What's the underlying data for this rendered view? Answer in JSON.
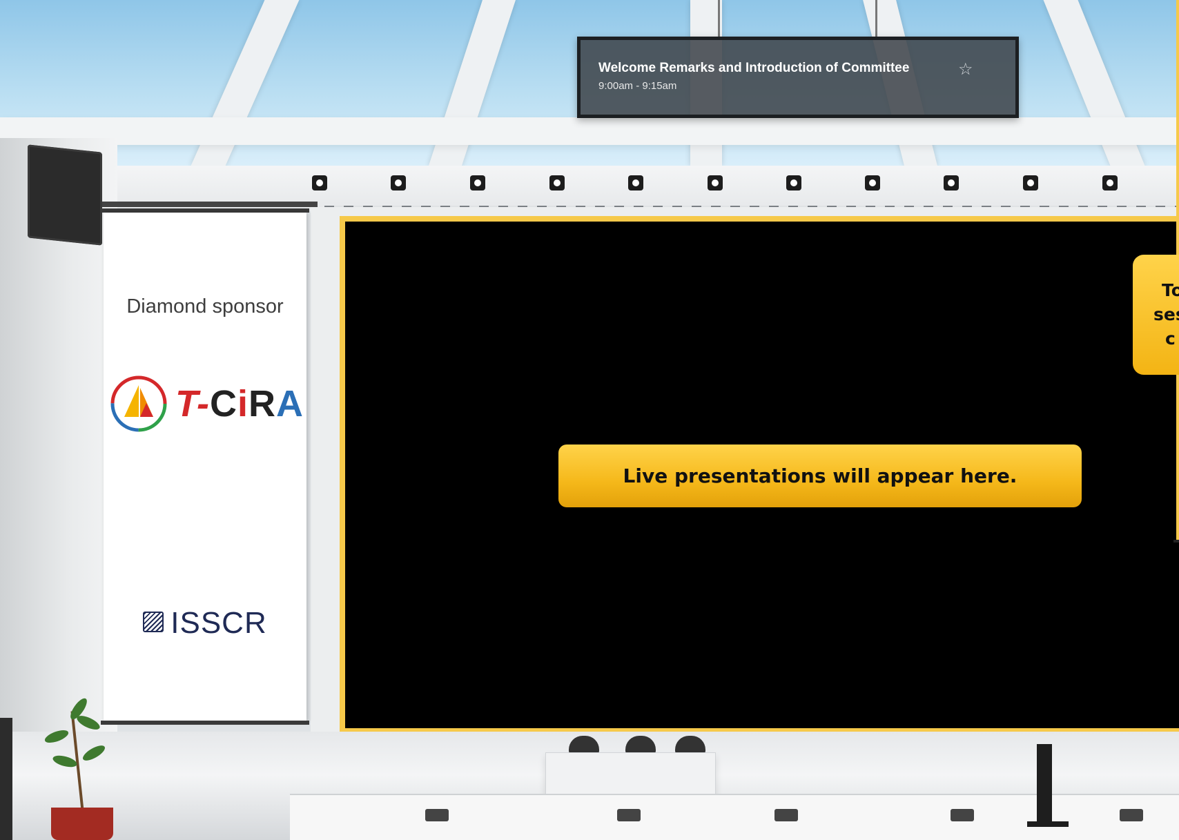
{
  "session": {
    "title": "Welcome Remarks and Introduction of Committee",
    "time": "9:00am - 9:15am",
    "favorite_icon": "star-outline-icon"
  },
  "sponsor_banner": {
    "label": "Diamond sponsor",
    "logo_primary": "T-CiRA",
    "logo_secondary": "ISSCR"
  },
  "screen": {
    "message": "Live presentations will appear here."
  },
  "side_note": {
    "line1": "To",
    "line2": "ses",
    "line3": "c"
  },
  "colors": {
    "accent": "#f6c94a",
    "banner_gradient_top": "#ffd34a",
    "banner_gradient_bottom": "#e3a10a",
    "sign_bg": "#3c4248"
  }
}
